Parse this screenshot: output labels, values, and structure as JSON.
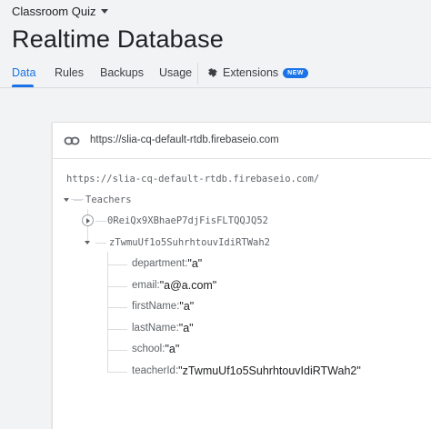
{
  "project": {
    "name": "Classroom Quiz"
  },
  "page": {
    "title": "Realtime Database"
  },
  "tabs": [
    {
      "label": "Data",
      "active": true
    },
    {
      "label": "Rules"
    },
    {
      "label": "Backups"
    },
    {
      "label": "Usage"
    }
  ],
  "extensions": {
    "label": "Extensions",
    "badge": "NEW"
  },
  "database": {
    "url": "https://slia-cq-default-rtdb.firebaseio.com",
    "root_url": "https://slia-cq-default-rtdb.firebaseio.com/",
    "root_node": "Teachers",
    "children": [
      {
        "key": "0ReiQx9XBhaeP7djFisFLTQQJQ52",
        "expanded": false
      },
      {
        "key": "zTwmuUf1o5SuhrhtouvIdiRTWah2",
        "expanded": true
      }
    ],
    "fields": [
      {
        "key": "department",
        "sep": ": ",
        "value": "\"a\""
      },
      {
        "key": "email",
        "sep": ": ",
        "value": "\"a@a.com\""
      },
      {
        "key": "firstName",
        "sep": ": ",
        "value": "\"a\""
      },
      {
        "key": "lastName",
        "sep": ": ",
        "value": "\"a\""
      },
      {
        "key": "school",
        "sep": ": ",
        "value": "\"a\""
      },
      {
        "key": "teacherId",
        "sep": ": ",
        "value": "\"zTwmuUf1o5SuhrhtouvIdiRTWah2\""
      }
    ]
  },
  "colors": {
    "accent": "#1a73e8",
    "background": "#f1f3f4",
    "panel": "#ffffff"
  },
  "icons": {
    "link": "link-icon",
    "extensions": "extensions-icon",
    "project_menu": "chevron-down-icon"
  }
}
